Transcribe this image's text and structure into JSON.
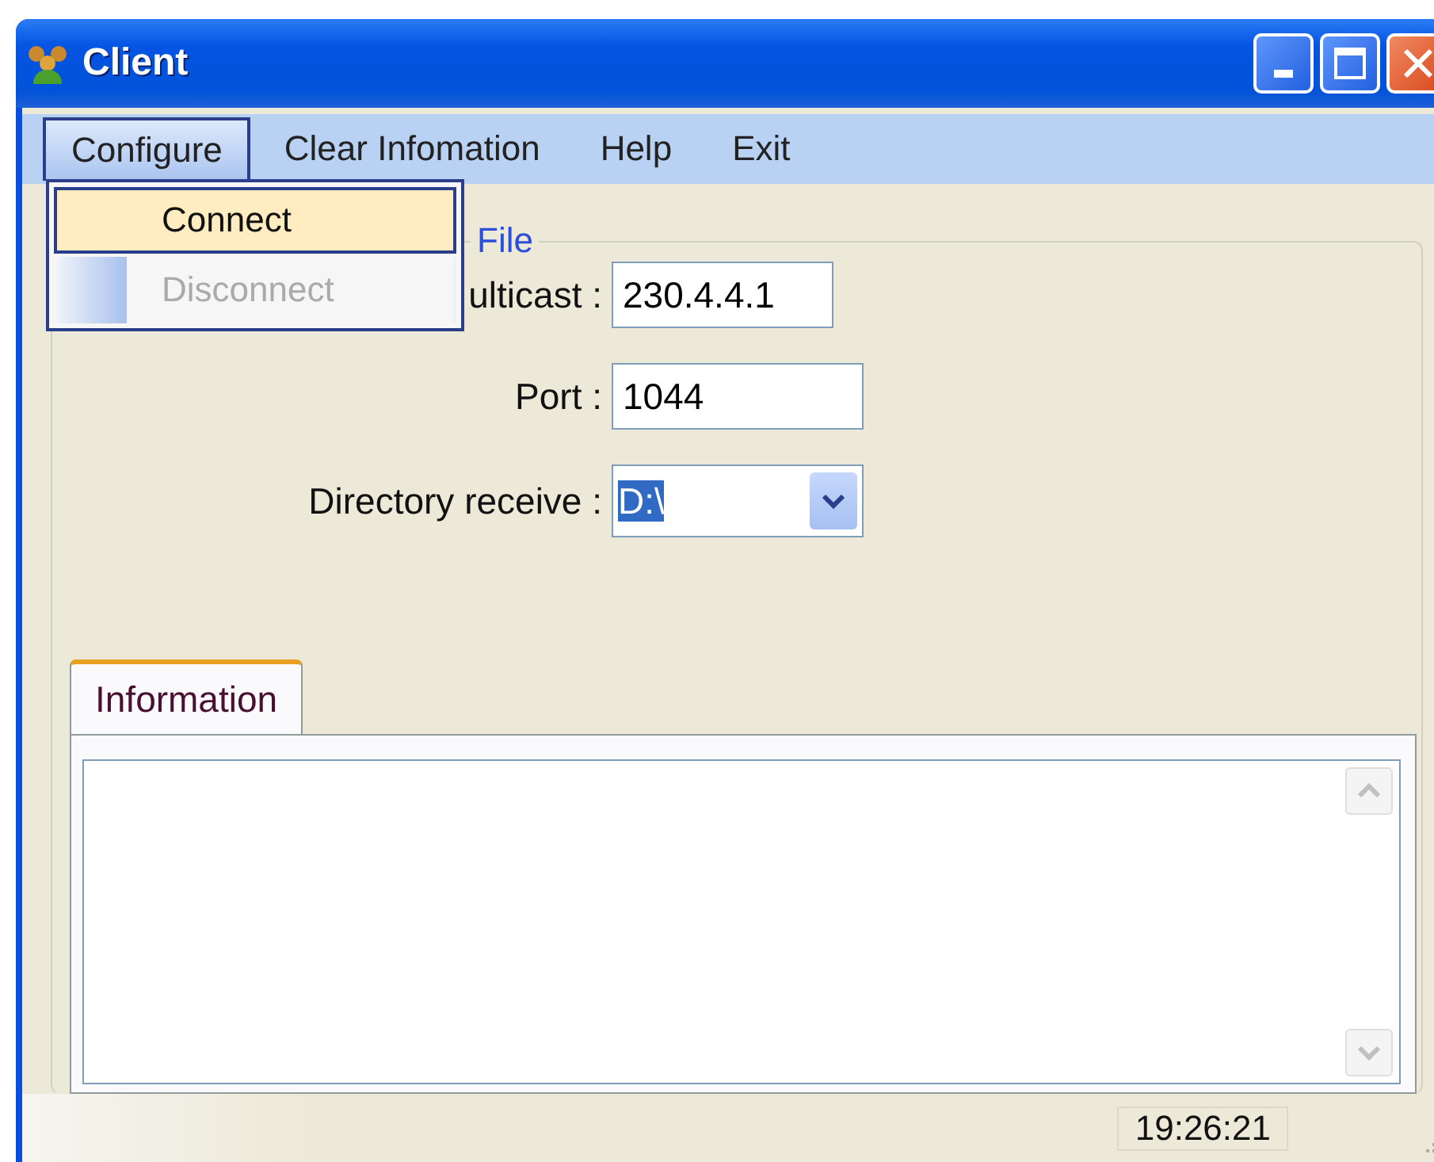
{
  "window": {
    "title": "Client"
  },
  "menu": [
    {
      "label": "Configure",
      "selected": true
    },
    {
      "label": "Clear Infomation",
      "selected": false
    },
    {
      "label": "Help",
      "selected": false
    },
    {
      "label": "Exit",
      "selected": false
    }
  ],
  "dropdown": [
    {
      "label": "Connect",
      "selected": true,
      "disabled": false
    },
    {
      "label": "Disconnect",
      "selected": false,
      "disabled": true
    }
  ],
  "group": {
    "legend": "File",
    "fields": [
      {
        "kind": "text",
        "label": "ulticast :",
        "value": "230.4.4.1"
      },
      {
        "kind": "text",
        "label": "Port :",
        "value": "1044"
      },
      {
        "kind": "combo",
        "label": "Directory receive :",
        "value": "D:\\"
      }
    ]
  },
  "tabs": [
    {
      "label": "Information",
      "selected": true
    }
  ],
  "status_bar": {
    "time": "19:26:21"
  }
}
